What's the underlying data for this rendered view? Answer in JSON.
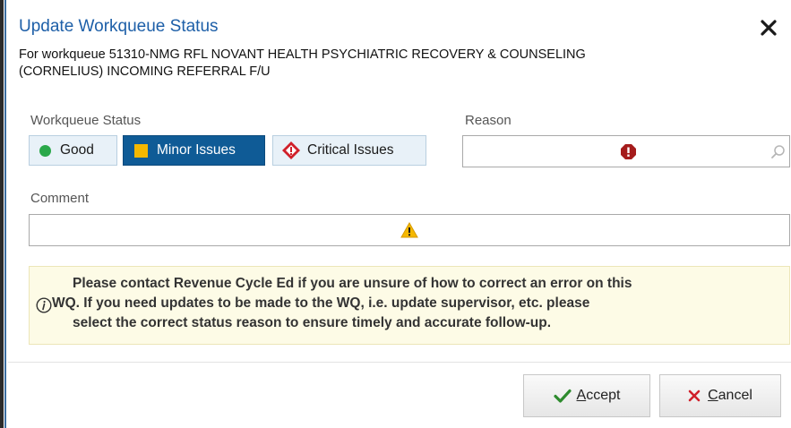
{
  "dialog": {
    "title": "Update Workqueue Status",
    "subtitle_line1": "For workqueue 51310-NMG RFL NOVANT HEALTH PSYCHIATRIC RECOVERY & COUNSELING",
    "subtitle_line2": "(CORNELIUS) INCOMING REFERRAL F/U",
    "close_icon": "close-icon"
  },
  "status": {
    "label": "Workqueue Status",
    "options": [
      {
        "label": "Good",
        "icon": "green-dot-icon",
        "color": "#2aa84a",
        "selected": false
      },
      {
        "label": "Minor Issues",
        "icon": "yellow-square-icon",
        "color": "#f5b800",
        "selected": true
      },
      {
        "label": "Critical Issues",
        "icon": "red-diamond-icon",
        "color": "#d0202a",
        "selected": false
      }
    ]
  },
  "reason": {
    "label": "Reason",
    "value": "",
    "required_icon": "error-icon",
    "search_icon": "magnifier-icon"
  },
  "comment": {
    "label": "Comment",
    "value": "",
    "warning_icon": "warning-icon"
  },
  "info": {
    "icon": "info-icon",
    "line1": "Please contact Revenue Cycle Ed if you are unsure of how to correct an error on this",
    "line2": "WQ. If you need updates to be made to the WQ, i.e. update supervisor, etc. please",
    "line3": "select the correct status reason to ensure timely and accurate follow-up."
  },
  "buttons": {
    "accept_first": "A",
    "accept_rest": "ccept",
    "cancel_first": "C",
    "cancel_rest": "ancel"
  },
  "colors": {
    "title": "#1d5fa8",
    "selected_button": "#0f5b96",
    "info_background": "#fdfbe6",
    "accept_check": "#2e8b2e",
    "cancel_x": "#d0202a"
  }
}
